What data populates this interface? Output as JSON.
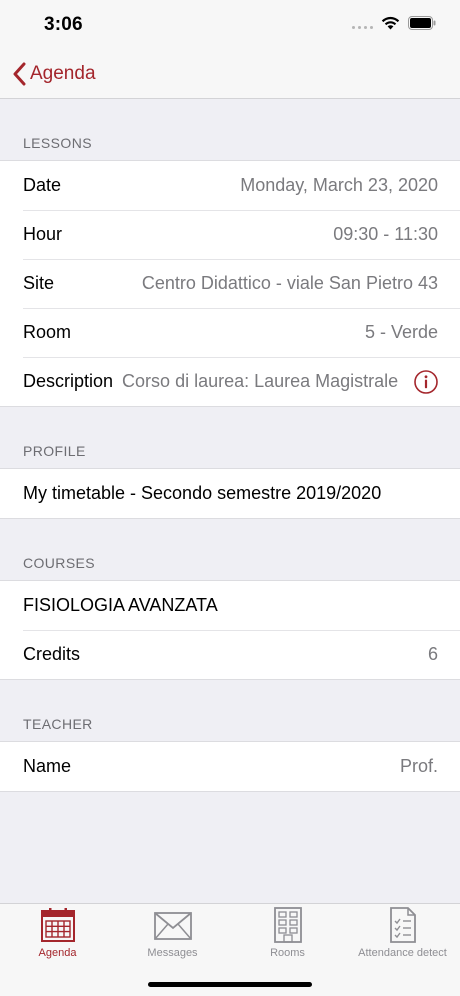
{
  "status_bar": {
    "time": "3:06"
  },
  "navbar": {
    "back_label": "Agenda"
  },
  "sections": {
    "lessons": {
      "header": "LESSONS",
      "rows": [
        {
          "label": "Date",
          "value": "Monday, March 23, 2020"
        },
        {
          "label": "Hour",
          "value": "09:30 - 11:30"
        },
        {
          "label": "Site",
          "value": "Centro Didattico - viale San Pietro 43"
        },
        {
          "label": "Room",
          "value": "5 - Verde"
        },
        {
          "label": "Description",
          "value": "Corso di laurea: Laurea Magistrale"
        }
      ]
    },
    "profile": {
      "header": "PROFILE",
      "value": "My timetable - Secondo semestre 2019/2020"
    },
    "courses": {
      "header": "COURSES",
      "course_name": "FISIOLOGIA AVANZATA",
      "credits_label": "Credits",
      "credits_value": "6"
    },
    "teacher": {
      "header": "TEACHER",
      "name_label": "Name",
      "name_value": "Prof."
    }
  },
  "tabbar": {
    "tabs": [
      {
        "label": "Agenda",
        "icon": "calendar-icon",
        "active": true
      },
      {
        "label": "Messages",
        "icon": "envelope-icon",
        "active": false
      },
      {
        "label": "Rooms",
        "icon": "building-icon",
        "active": false
      },
      {
        "label": "Attendance detect",
        "icon": "checklist-icon",
        "active": false
      }
    ]
  },
  "colors": {
    "accent": "#a4262c",
    "background": "#efeff4",
    "secondary_text": "#7a7a7e",
    "tab_inactive": "#8e8e93"
  }
}
